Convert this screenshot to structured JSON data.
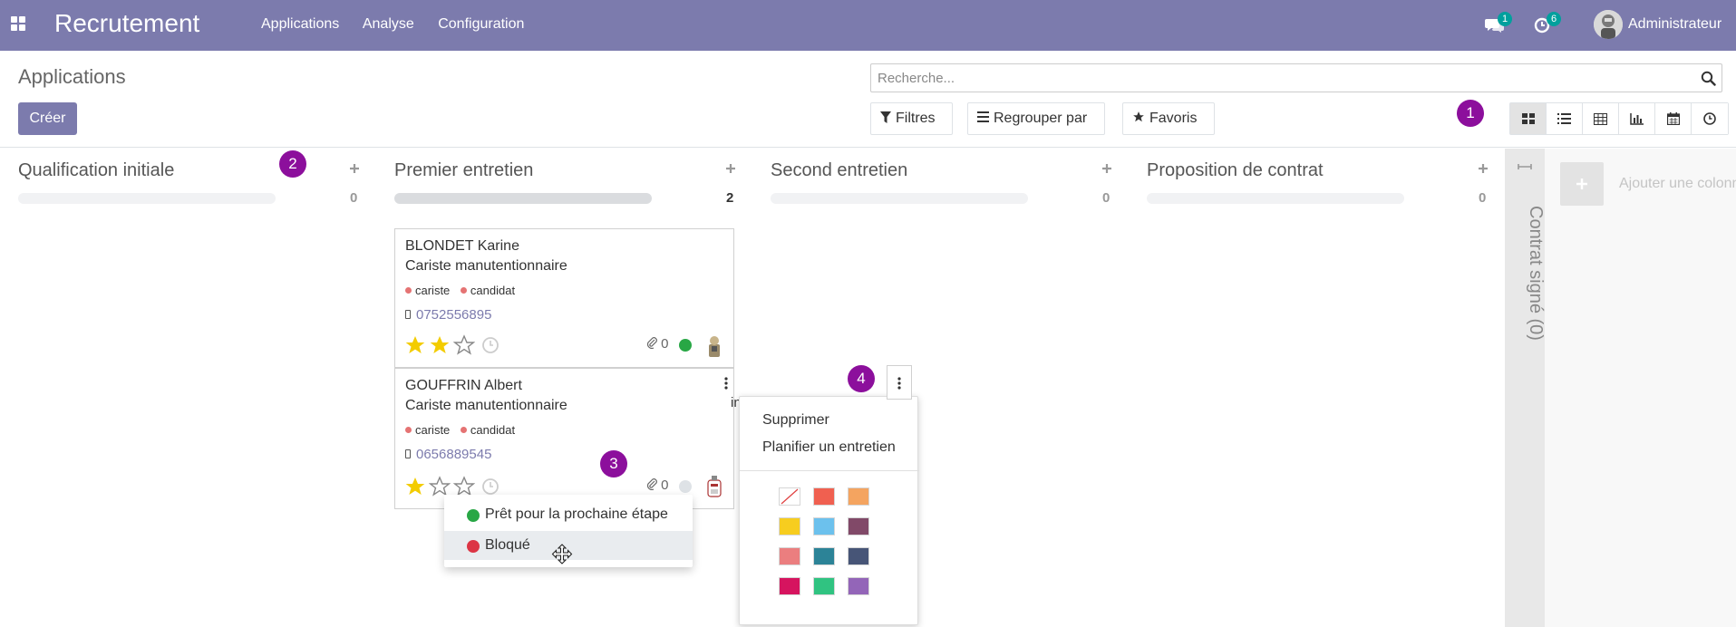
{
  "navbar": {
    "app_title": "Recrutement",
    "menu": [
      "Applications",
      "Analyse",
      "Configuration"
    ],
    "chat_badge": "1",
    "activity_badge": "6",
    "user_name": "Administrateur",
    "accent_color": "#7c7bad"
  },
  "control_panel": {
    "breadcrumb": "Applications",
    "create_label": "Créer",
    "search_placeholder": "Recherche...",
    "filters_label": "Filtres",
    "group_by_label": "Regrouper par",
    "favorites_label": "Favoris",
    "views": [
      "kanban-icon",
      "list-icon",
      "table-icon",
      "chart-icon",
      "calendar-icon",
      "activity-clock-icon"
    ],
    "active_view": "kanban-icon"
  },
  "steps": [
    "1",
    "2",
    "3",
    "4"
  ],
  "columns": [
    {
      "title": "Qualification initiale",
      "count": "0"
    },
    {
      "title": "Premier entretien",
      "count": "2"
    },
    {
      "title": "Second entretien",
      "count": "0"
    },
    {
      "title": "Proposition de contrat",
      "count": "0"
    }
  ],
  "folded_column": {
    "title": "Contrat signé (0)"
  },
  "add_column_label": "Ajouter une colonne",
  "cards": [
    {
      "name": "BLONDET Karine",
      "job": "Cariste manutentionnaire",
      "tags": [
        "cariste",
        "candidat"
      ],
      "phone": "0752556895",
      "stars_filled": 2,
      "attachments": "0",
      "state_color": "#28a745"
    },
    {
      "name": "GOUFFRIN Albert",
      "job": "Cariste manutentionnaire",
      "tags": [
        "cariste",
        "candidat"
      ],
      "phone": "0656889545",
      "stars_filled": 1,
      "attachments": "0",
      "state_color": "#dee2e6",
      "overflow_text": "in"
    }
  ],
  "state_dropdown": [
    {
      "label": "Prêt pour la prochaine étape",
      "color": "#28a745"
    },
    {
      "label": "Bloqué",
      "color": "#dc3545"
    }
  ],
  "card_menu": {
    "items": [
      "Supprimer",
      "Planifier un entretien"
    ],
    "colors": [
      "none",
      "#f06050",
      "#f4a460",
      "#f7cd1f",
      "#6cc1ed",
      "#814968",
      "#eb7e7f",
      "#2c8397",
      "#475577",
      "#d6145f",
      "#30c381",
      "#9365b8"
    ]
  }
}
